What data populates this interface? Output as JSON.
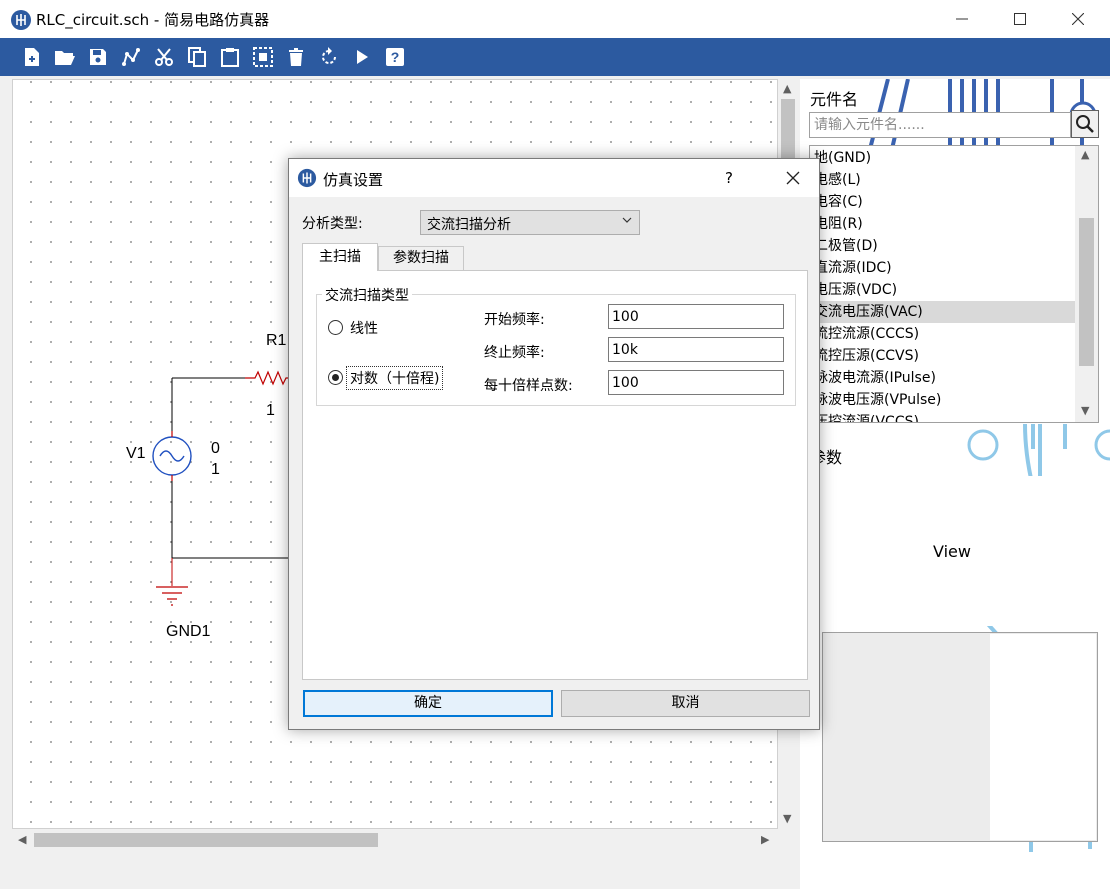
{
  "window": {
    "title": "RLC_circuit.sch - 简易电路仿真器",
    "accent_color": "#2c5aa0"
  },
  "toolbar": {
    "buttons": [
      {
        "name": "new-file",
        "icon": "new-file-icon"
      },
      {
        "name": "open-folder",
        "icon": "open-folder-icon"
      },
      {
        "name": "save",
        "icon": "save-icon"
      },
      {
        "name": "wire",
        "icon": "wire-icon"
      },
      {
        "name": "cut",
        "icon": "scissors-icon"
      },
      {
        "name": "copy",
        "icon": "copy-icon"
      },
      {
        "name": "paste",
        "icon": "clipboard-icon"
      },
      {
        "name": "select",
        "icon": "select-icon"
      },
      {
        "name": "delete",
        "icon": "trash-icon"
      },
      {
        "name": "rotate",
        "icon": "rotate-icon"
      },
      {
        "name": "run",
        "icon": "play-icon"
      },
      {
        "name": "help",
        "icon": "help-icon"
      }
    ]
  },
  "schematic": {
    "r1_label": "R1",
    "r1_node": "1",
    "v1_label": "V1",
    "v1_param_0": "0",
    "v1_param_1": "1",
    "gnd_label": "GND1",
    "wire_color": "#000000",
    "component_color": "#c00000",
    "source_color": "#2050c0"
  },
  "right_panel": {
    "component_name_label": "元件名",
    "search_placeholder": "请输入元件名......",
    "components": [
      "地(GND)",
      "电感(L)",
      "电容(C)",
      "电阻(R)",
      "二极管(D)",
      "直流源(IDC)",
      "电压源(VDC)",
      "交流电压源(VAC)",
      "流控流源(CCCS)",
      "流控压源(CCVS)",
      "脉波电流源(IPulse)",
      "脉波电压源(VPulse)",
      "压控流源(VCCS)"
    ],
    "selected_index": 7,
    "params_label": "参数",
    "view_label": "View"
  },
  "dialog": {
    "title": "仿真设置",
    "help": "?",
    "analysis_label": "分析类型:",
    "analysis_value": "交流扫描分析",
    "tabs": [
      "主扫描",
      "参数扫描"
    ],
    "group_title": "交流扫描类型",
    "radio_linear": "线性",
    "radio_log": "对数（十倍程)",
    "start_freq_label": "开始频率:",
    "start_freq_value": "100",
    "stop_freq_label": "终止频率:",
    "stop_freq_value": "10k",
    "points_label": "每十倍样点数:",
    "points_value": "100",
    "ok": "确定",
    "cancel": "取消"
  }
}
